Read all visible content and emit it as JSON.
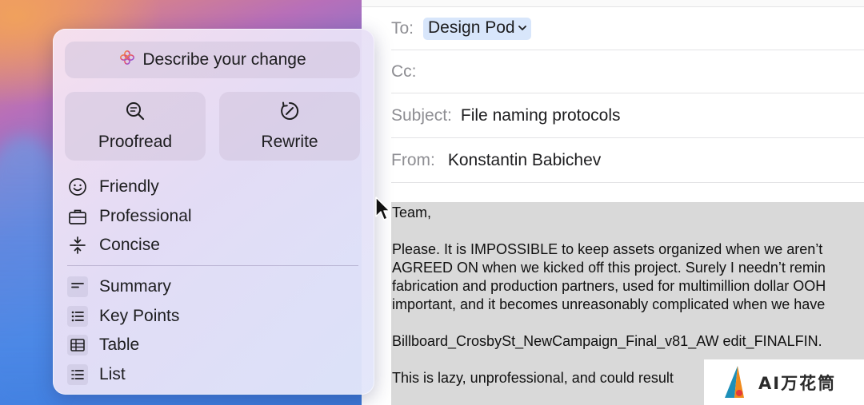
{
  "mail": {
    "to_label": "To:",
    "to_recipient": "Design Pod",
    "cc_label": "Cc:",
    "subject_label": "Subject:",
    "subject_value": "File naming protocols",
    "from_label": "From:",
    "from_value": "Konstantin Babichev",
    "body_lines": [
      "Team,",
      "",
      "Please. It is IMPOSSIBLE to keep assets organized when we aren’t",
      "AGREED ON when we kicked off this project. Surely I needn’t remin",
      "fabrication and production partners, used for multimillion dollar OOH",
      "important, and it becomes unreasonably complicated when we have",
      "",
      "Billboard_CrosbySt_NewCampaign_Final_v81_AW edit_FINALFIN.",
      "",
      "This is lazy, unprofessional, and could result"
    ]
  },
  "writing_tools": {
    "describe_label": "Describe your change",
    "proofread_label": "Proofread",
    "rewrite_label": "Rewrite",
    "tone_items": [
      {
        "label": "Friendly",
        "icon": "smiley-icon"
      },
      {
        "label": "Professional",
        "icon": "briefcase-icon"
      },
      {
        "label": "Concise",
        "icon": "compress-icon"
      }
    ],
    "format_items": [
      {
        "label": "Summary",
        "icon": "summary-icon"
      },
      {
        "label": "Key Points",
        "icon": "bullet-list-icon"
      },
      {
        "label": "Table",
        "icon": "table-icon"
      },
      {
        "label": "List",
        "icon": "numbered-list-icon"
      }
    ]
  },
  "watermark": {
    "text": "AI万花筒"
  },
  "colors": {
    "chip_bg": "#d8e6fb",
    "label_gray": "#8e8e93",
    "body_selection": "#d9d9d9",
    "panel_tint": "#e8e0f6"
  }
}
